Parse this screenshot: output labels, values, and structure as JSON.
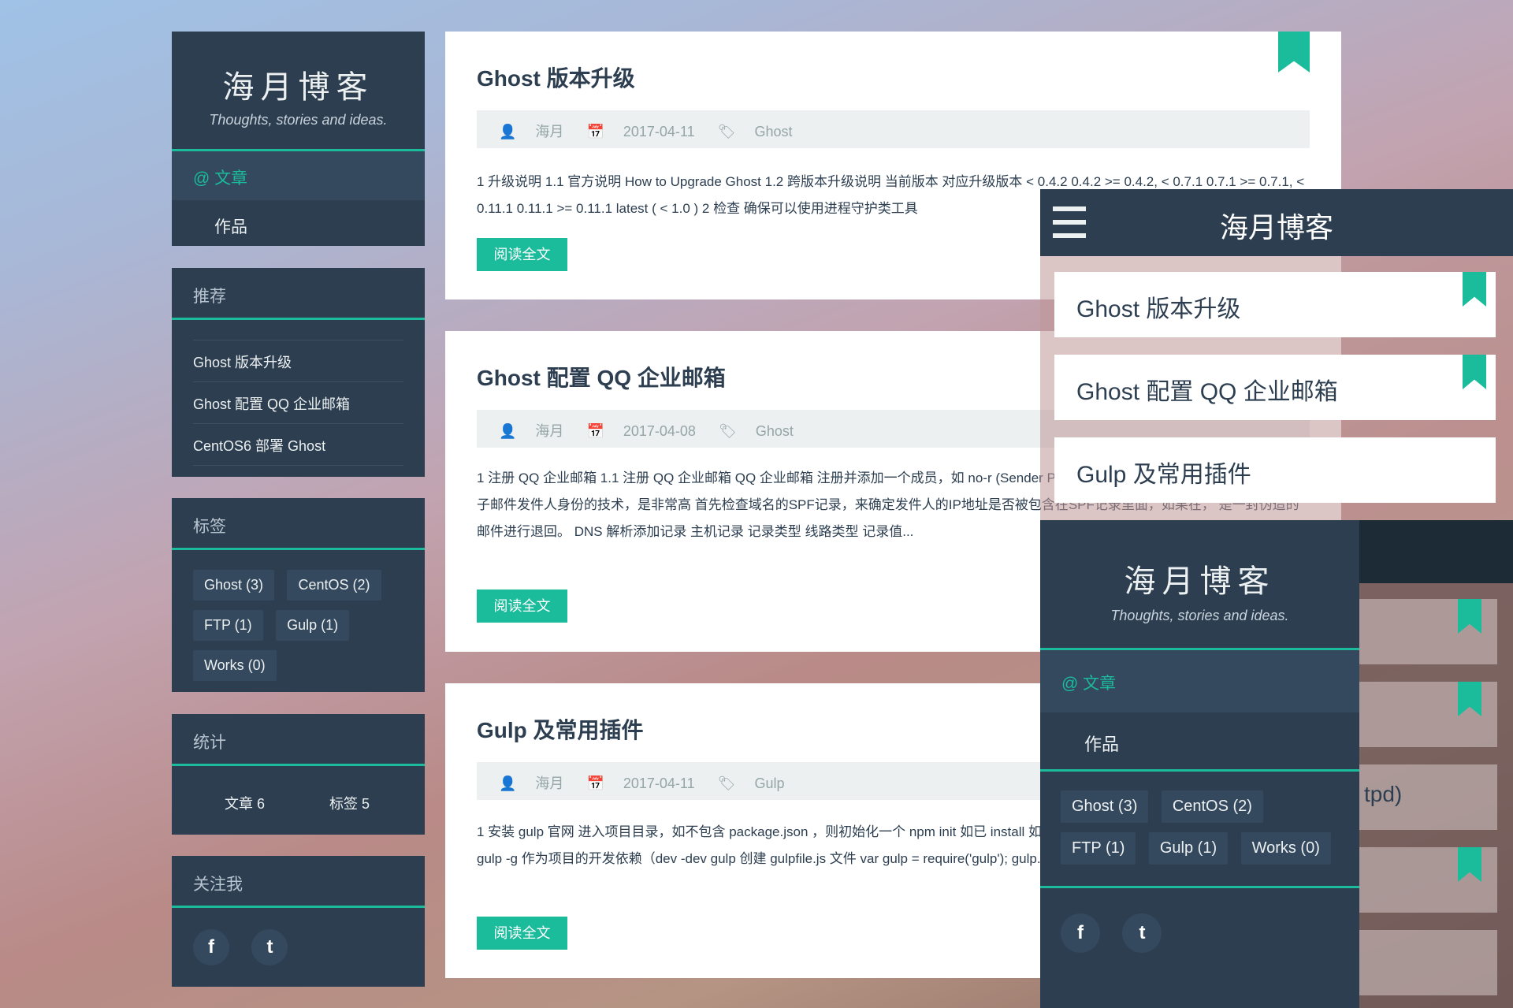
{
  "sidebar": {
    "title": "海月博客",
    "subtitle": "Thoughts, stories and ideas.",
    "nav_active": "@ 文章",
    "nav_item": "作品",
    "recommend": {
      "title": "推荐",
      "items": [
        "Ghost 版本升级",
        "Ghost 配置 QQ 企业邮箱",
        "CentOS6 部署 Ghost"
      ]
    },
    "tags": {
      "title": "标签",
      "items": [
        "Ghost (3)",
        "CentOS (2)",
        "FTP (1)",
        "Gulp (1)",
        "Works (0)"
      ]
    },
    "stats": {
      "title": "统计",
      "articles": "文章 6",
      "tags": "标签 5"
    },
    "follow": {
      "title": "关注我",
      "facebook": "f",
      "twitter": "t"
    }
  },
  "posts": [
    {
      "title": "Ghost 版本升级",
      "author": "海月",
      "date": "2017-04-11",
      "tag": "Ghost",
      "excerpt": "1 升级说明 1.1 官方说明 How to Upgrade Ghost 1.2 跨版本升级说明 当前版本 对应升级版本 < 0.4.2 0.4.2 >= 0.4.2, < 0.7.1 0.7.1 >= 0.7.1, < 0.11.1 0.11.1 >= 0.11.1 latest ( < 1.0 ) 2 检查 确保可以使用进程守护类工具",
      "read_more": "阅读全文"
    },
    {
      "title": "Ghost 配置 QQ 企业邮箱",
      "author": "海月",
      "date": "2017-04-08",
      "tag": "Ghost",
      "excerpt": "1 注册 QQ 企业邮箱 1.1 注册 QQ 企业邮箱 QQ 企业邮箱 注册并添加一个成员，如 no-r (Sender Policy Framework) 是一种以 IP 地址认证电子邮件发件人身份的技术，是非常高 首先检查域名的SPF记录，来确定发件人的IP地址是否被包含在SPF记录里面，如果在， 是一封伪造的邮件进行退回。 DNS 解析添加记录 主机记录 记录类型 线路类型 记录值...",
      "read_more": "阅读全文"
    },
    {
      "title": "Gulp 及常用插件",
      "author": "海月",
      "date": "2017-04-11",
      "tag": "Gulp",
      "excerpt": "1 安装 gulp 官网 进入项目目录，如不包含 package.json ，则初始化一个 npm init 如已 install 如第一次安装，则先全局安装 gulp npm install gulp -g 作为项目的开发依赖（dev -dev gulp 创建 gulpfile.js 文件 var gulp = require('gulp'); gulp.task('default', function() {",
      "read_more": "阅读全文"
    }
  ],
  "mobile": {
    "title": "海月博客",
    "cards": [
      "Ghost 版本升级",
      "Ghost 配置 QQ 企业邮箱",
      "Gulp 及常用插件"
    ],
    "drawer": {
      "title": "海月博客",
      "subtitle": "Thoughts, stories and ideas.",
      "nav_active": "@ 文章",
      "nav_item": "作品",
      "tags": [
        "Ghost (3)",
        "CentOS (2)",
        "FTP (1)",
        "Gulp (1)",
        "Works (0)"
      ],
      "partial_text": "tpd)"
    }
  },
  "colors": {
    "dark": "#2c3e50",
    "accent": "#1abc9c",
    "meta_bg": "#ecf0f1"
  }
}
